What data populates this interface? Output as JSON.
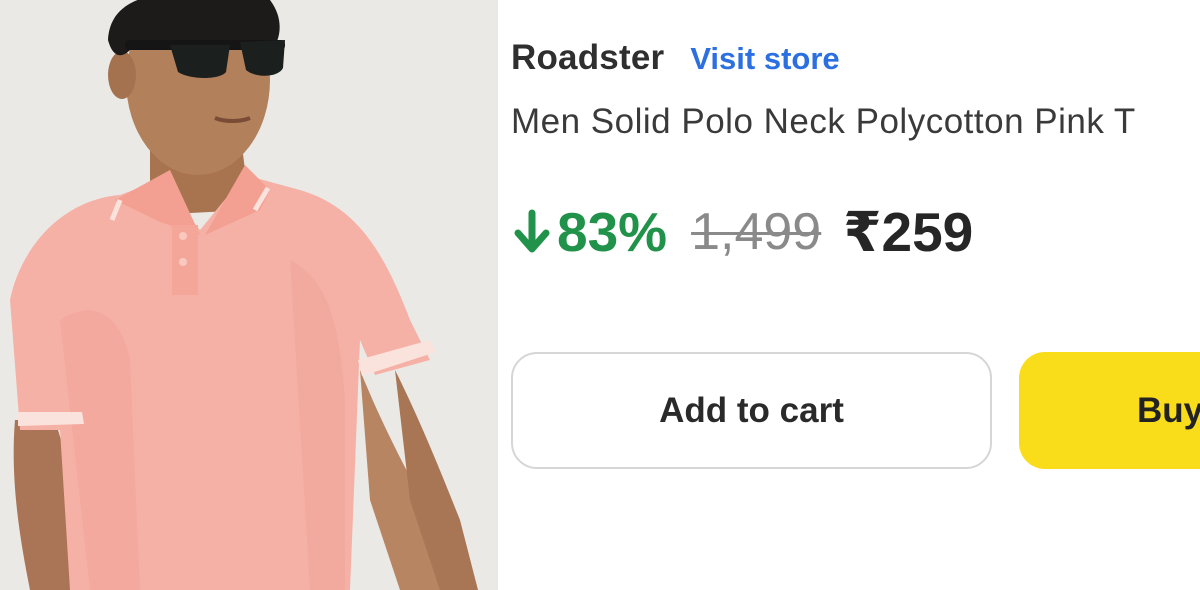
{
  "product": {
    "brand": "Roadster",
    "visit_store_label": "Visit store",
    "title": "Men Solid Polo Neck Polycotton Pink T",
    "image_icon": "product-photo",
    "colors": {
      "discount": "#21924a",
      "link": "#2b6fe0",
      "buy": "#f9dd1b"
    }
  },
  "pricing": {
    "discount_icon": "arrow-down-icon",
    "discount": "83%",
    "mrp": "1,499",
    "price": "₹259"
  },
  "actions": {
    "add_to_cart_label": "Add to cart",
    "buy_label": "Buy"
  }
}
